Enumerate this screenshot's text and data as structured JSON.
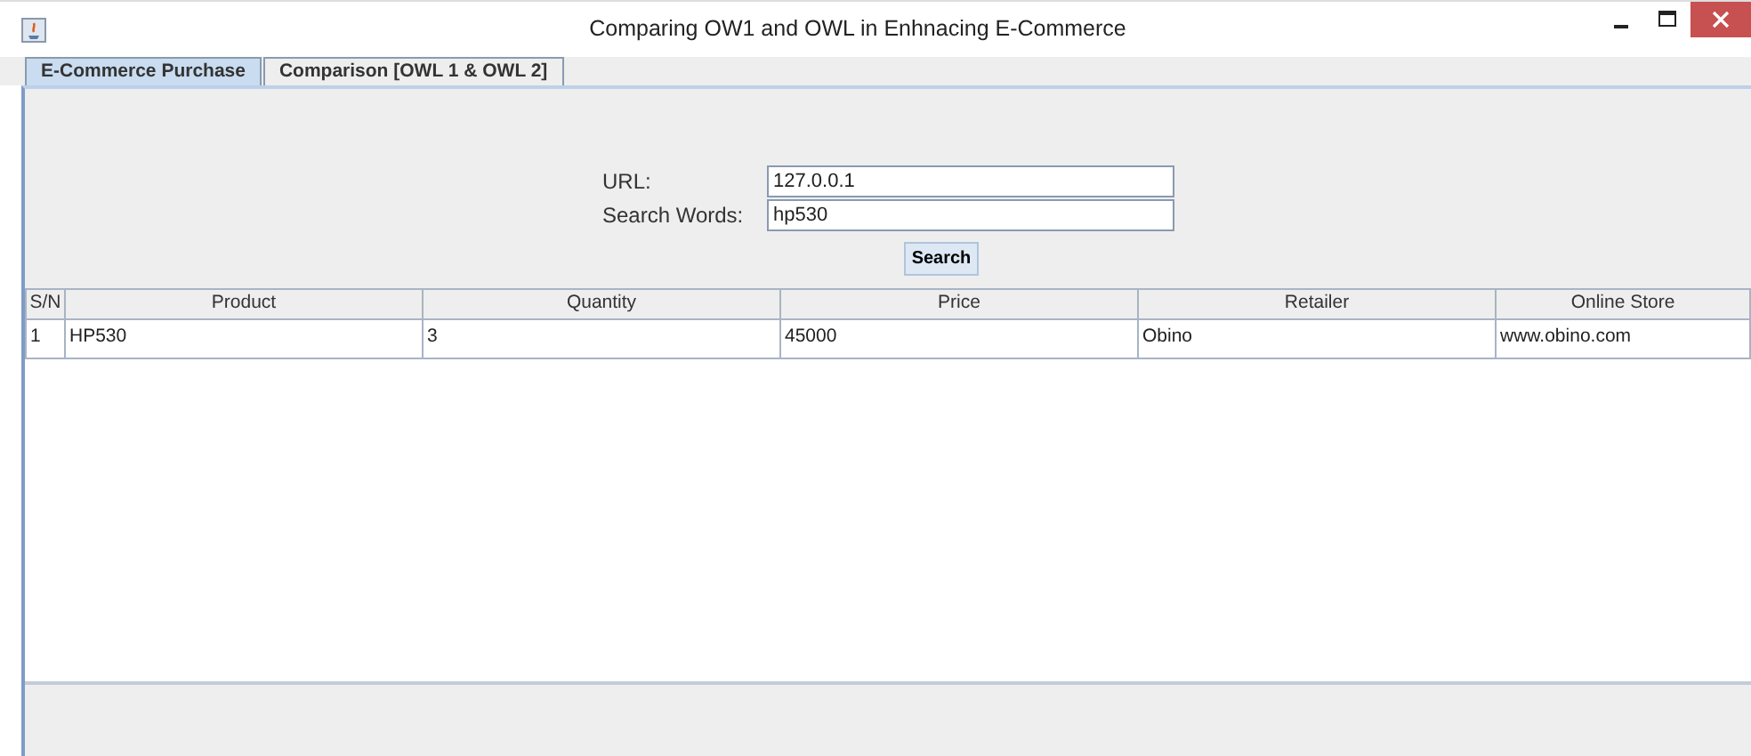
{
  "window": {
    "title": "Comparing OW1 and OWL in Enhnacing E-Commerce"
  },
  "tabs": [
    {
      "label": "E-Commerce Purchase",
      "selected": true
    },
    {
      "label": "Comparison [OWL 1 & OWL 2]",
      "selected": false
    }
  ],
  "form": {
    "fields": [
      {
        "label": "URL:",
        "value": "127.0.0.1"
      },
      {
        "label": "Search Words:",
        "value": "hp530"
      }
    ],
    "button": "Search"
  },
  "table": {
    "columns": [
      "S/N",
      "Product",
      "Quantity",
      "Price",
      "Retailer",
      "Online Store"
    ],
    "rows": [
      [
        "1",
        "HP530",
        "3",
        "45000",
        "Obino",
        "www.obino.com"
      ]
    ]
  }
}
